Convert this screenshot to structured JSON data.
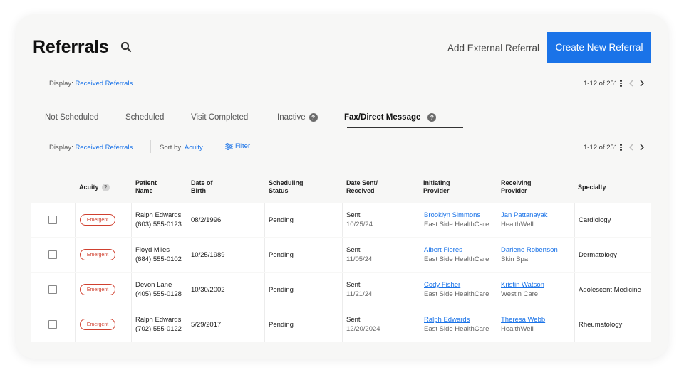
{
  "header": {
    "title": "Referrals",
    "add_external": "Add External Referral",
    "create_new": "Create New Referral"
  },
  "top_display": {
    "label": "Display:",
    "value": "Received Referrals"
  },
  "top_pager": {
    "range": "1-12 of 251"
  },
  "tabs": [
    {
      "label": "Not Scheduled",
      "active": false,
      "help": false
    },
    {
      "label": "Scheduled",
      "active": false,
      "help": false
    },
    {
      "label": "Visit Completed",
      "active": false,
      "help": false
    },
    {
      "label": "Inactive",
      "active": false,
      "help": true
    },
    {
      "label": "Fax/Direct Message",
      "active": true,
      "help": true
    }
  ],
  "help_glyph": "?",
  "toolbar": {
    "display_label": "Display:",
    "display_value": "Received Referrals",
    "sort_label": "Sort by:",
    "sort_value": "Acuity",
    "filter_label": "Filter",
    "range": "1-12 of 251"
  },
  "columns": {
    "acuity": "Acuity",
    "patient": [
      "Patient",
      "Name"
    ],
    "dob": [
      "Date of",
      "Birth"
    ],
    "status": [
      "Scheduling",
      "Status"
    ],
    "sent": [
      "Date Sent/",
      "Received"
    ],
    "initiating": [
      "Initiating",
      "Provider"
    ],
    "receiving": [
      "Receiving",
      "Provider"
    ],
    "specialty": "Specialty"
  },
  "rows": [
    {
      "acuity": "Emergent",
      "name": "Ralph Edwards",
      "phone": "(603) 555-0123",
      "dob": "08/2/1996",
      "status": "Pending",
      "sent": "Sent",
      "sent_date": "10/25/24",
      "init_provider": "Brooklyn Simmons",
      "init_org": "East Side HealthCare",
      "recv_provider": "Jan Pattanayak",
      "recv_org": "HealthWell",
      "specialty": "Cardiology"
    },
    {
      "acuity": "Emergent",
      "name": "Floyd Miles",
      "phone": "(684) 555-0102",
      "dob": "10/25/1989",
      "status": "Pending",
      "sent": "Sent",
      "sent_date": "11/05/24",
      "init_provider": "Albert Flores",
      "init_org": "East Side HealthCare",
      "recv_provider": "Darlene Robertson",
      "recv_org": "Skin Spa",
      "specialty": "Dermatology"
    },
    {
      "acuity": "Emergent",
      "name": "Devon Lane",
      "phone": "(405) 555-0128",
      "dob": "10/30/2002",
      "status": "Pending",
      "sent": "Sent",
      "sent_date": "11/21/24",
      "init_provider": "Cody Fisher",
      "init_org": "East Side HealthCare",
      "recv_provider": "Kristin Watson",
      "recv_org": "Westin Care",
      "specialty": "Adolescent Medicine"
    },
    {
      "acuity": "Emergent",
      "name": "Ralph Edwards",
      "phone": "(702) 555-0122",
      "dob": "5/29/2017",
      "status": "Pending",
      "sent": "Sent",
      "sent_date": "12/20/2024",
      "init_provider": "Ralph Edwards",
      "init_org": "East Side HealthCare",
      "recv_provider": "Theresa Webb",
      "recv_org": "HealthWell",
      "specialty": "Rheumatology"
    }
  ],
  "colors": {
    "accent": "#1a73e8",
    "emergent": "#d0402f",
    "card_bg": "#f7f7f6"
  }
}
